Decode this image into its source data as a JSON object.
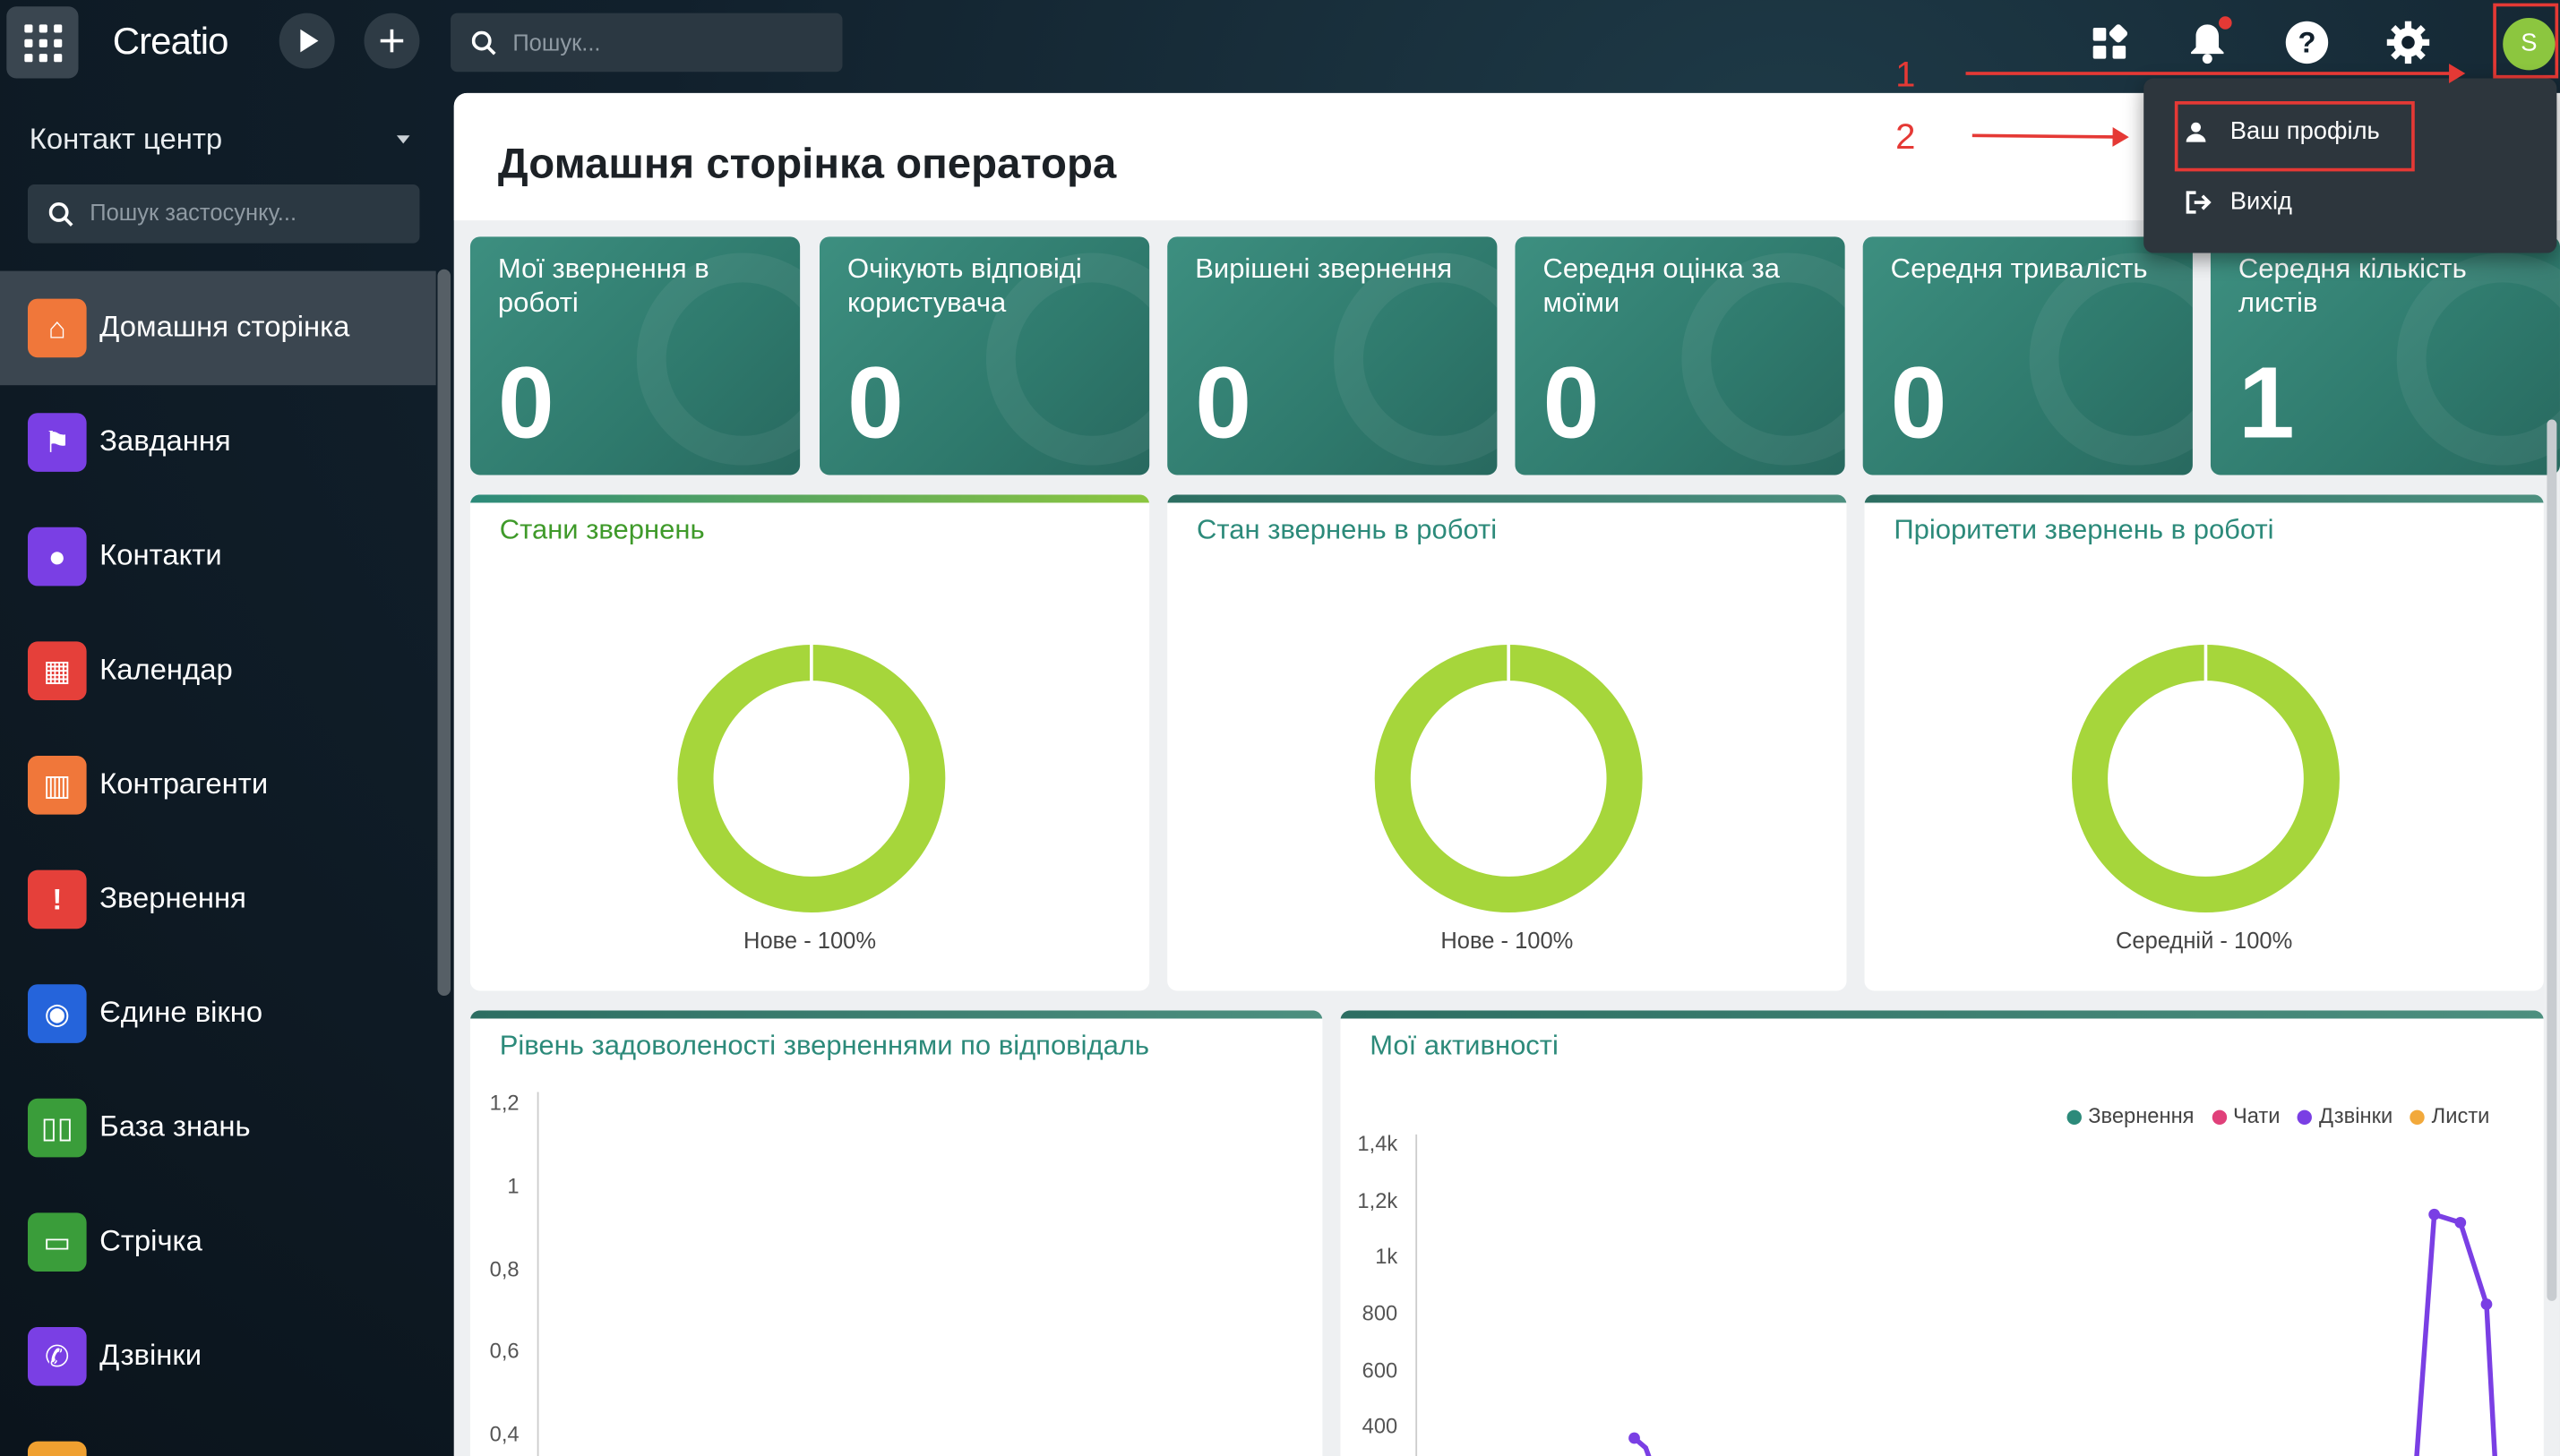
{
  "brand": {
    "logo": "Creatio",
    "accent": "#2f7a6d",
    "lime": "#a6d63b"
  },
  "header": {
    "search_placeholder": "Пошук...",
    "avatar_initial": "S",
    "annotation_1": "1",
    "annotation_2": "2"
  },
  "user_menu": {
    "profile": "Ваш профіль",
    "logout": "Вихід"
  },
  "sidebar": {
    "workspace": "Контакт центр",
    "app_search_placeholder": "Пошук застосунку...",
    "items": [
      {
        "label": "Домашня сторінка",
        "icon": "home-icon",
        "color": "#f0773a"
      },
      {
        "label": "Завдання",
        "icon": "flag-icon",
        "color": "#7a3fe4"
      },
      {
        "label": "Контакти",
        "icon": "person-icon",
        "color": "#7a3fe4"
      },
      {
        "label": "Календар",
        "icon": "calendar-icon",
        "color": "#e5403a"
      },
      {
        "label": "Контрагенти",
        "icon": "building-icon",
        "color": "#f0773a"
      },
      {
        "label": "Звернення",
        "icon": "alert-message-icon",
        "color": "#e5403a"
      },
      {
        "label": "Єдине вікно",
        "icon": "agent-desk-icon",
        "color": "#2564db"
      },
      {
        "label": "База знань",
        "icon": "book-icon",
        "color": "#3a9d3a"
      },
      {
        "label": "Стрічка",
        "icon": "chat-feed-icon",
        "color": "#3a9d3a"
      },
      {
        "label": "Дзвінки",
        "icon": "phone-icon",
        "color": "#7a3fe4"
      }
    ]
  },
  "page": {
    "title": "Домашня сторінка оператора"
  },
  "kpis": [
    {
      "label": "Мої звернення в роботі",
      "value": "0"
    },
    {
      "label": "Очікують відповіді користувача",
      "value": "0"
    },
    {
      "label": "Вирішені звернення",
      "value": "0"
    },
    {
      "label": "Середня оцінка за моїми",
      "value": "0"
    },
    {
      "label": "Середня тривалість",
      "value": "0"
    },
    {
      "label": "Середня кількість листів",
      "value": "1"
    }
  ],
  "donuts": [
    {
      "title": "Стани звернень",
      "label": "Нове - 100%"
    },
    {
      "title": "Стан звернень в роботі",
      "label": "Нове - 100%"
    },
    {
      "title": "Пріоритети звернень в роботі",
      "label": "Середній - 100%"
    }
  ],
  "satisfaction": {
    "title": "Рівень задоволеності зверненнями по відповідаль",
    "yticks": [
      "1,2",
      "1",
      "0,8",
      "0,6",
      "0,4"
    ]
  },
  "activities": {
    "title": "Мої активності",
    "yticks": [
      "1,4k",
      "1,2k",
      "1k",
      "800",
      "600",
      "400"
    ],
    "legend": [
      {
        "name": "Звернення",
        "color": "#2c8a7a"
      },
      {
        "name": "Чати",
        "color": "#e0407a"
      },
      {
        "name": "Дзвінки",
        "color": "#7a3fe4"
      },
      {
        "name": "Листи",
        "color": "#f2a93b"
      }
    ]
  },
  "chart_data": [
    {
      "type": "pie",
      "title": "Стани звернень",
      "categories": [
        "Нове"
      ],
      "values": [
        100
      ]
    },
    {
      "type": "pie",
      "title": "Стан звернень в роботі",
      "categories": [
        "Нове"
      ],
      "values": [
        100
      ]
    },
    {
      "type": "pie",
      "title": "Пріоритети звернень в роботі",
      "categories": [
        "Середній"
      ],
      "values": [
        100
      ]
    },
    {
      "type": "line",
      "title": "Мої активності",
      "series": [
        {
          "name": "Дзвінки",
          "values": [
            340,
            1140,
            1120,
            960
          ]
        }
      ],
      "ylim": [
        400,
        1400
      ]
    }
  ]
}
